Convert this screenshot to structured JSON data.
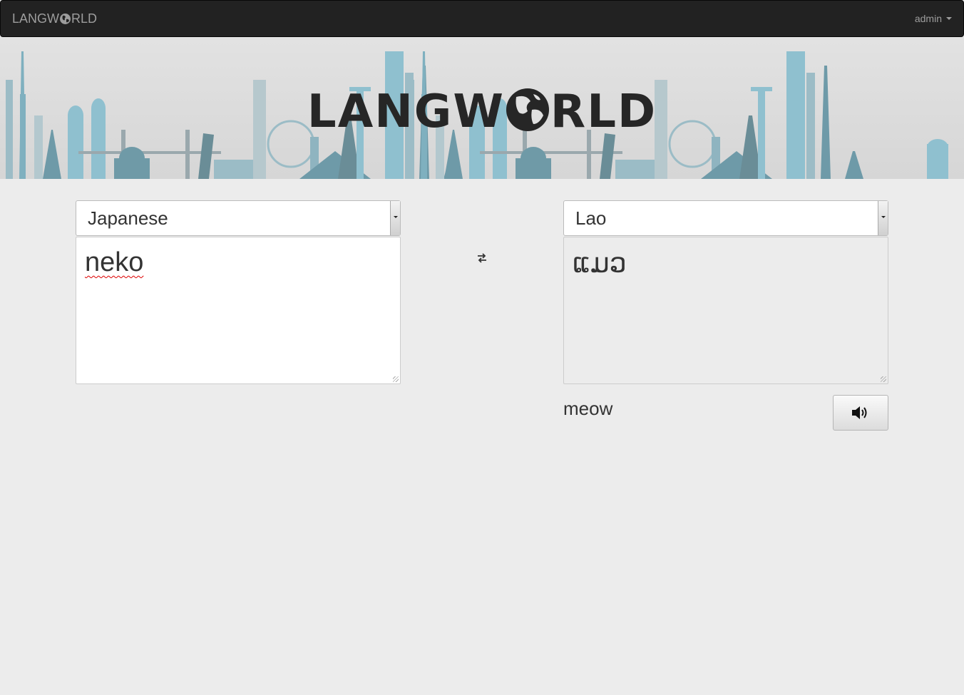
{
  "navbar": {
    "brand_prefix": "LANGW",
    "brand_suffix": "RLD",
    "user": "admin"
  },
  "hero": {
    "logo_prefix": "LANGW",
    "logo_suffix": "RLD"
  },
  "source": {
    "language": "Japanese",
    "text": "neko"
  },
  "target": {
    "language": "Lao",
    "text": "ແມວ",
    "transliteration": "meow"
  },
  "icons": {
    "swap": "swap-arrows-icon",
    "speak": "volume-up-icon",
    "globe": "globe-icon"
  },
  "colors": {
    "navbar_bg": "#222222",
    "page_bg": "#ececec",
    "skyline_teal": "#7fb5c2",
    "skyline_gray": "#8fa0a6"
  }
}
